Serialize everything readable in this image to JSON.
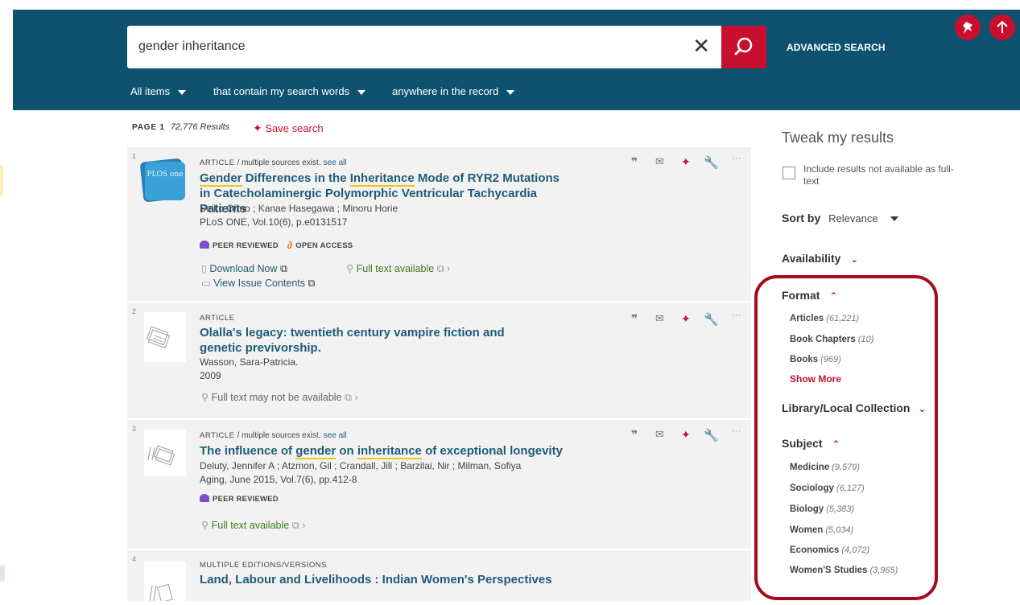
{
  "search": {
    "query": "gender inheritance",
    "advanced_label": "ADVANCED SEARCH",
    "filters": [
      "All items",
      "that contain my search words",
      "anywhere in the record"
    ]
  },
  "results_meta": {
    "page_label": "PAGE 1",
    "count": "72,776 Results",
    "save_search": "Save search"
  },
  "results": [
    {
      "index": "1",
      "type": "ARTICLE",
      "multi_sources": "/ multiple sources exist.",
      "see_all": "see all",
      "title_parts": [
        "Gender",
        " Differences in the ",
        "Inheritance",
        " Mode of RYR2 Mutations in Catecholaminergic Polymorphic Ventricular Tachycardia Patients"
      ],
      "authors": "Seiko Ohno ; Kanae Hasegawa ; Minoru Horie",
      "source": "PLoS ONE, Vol.10(6), p.e0131517",
      "peer_reviewed": "PEER REVIEWED",
      "open_access": "OPEN ACCESS",
      "download": "Download Now",
      "full_text": "Full text available",
      "issue_contents": "View Issue Contents",
      "thumb_text": "PLOS one"
    },
    {
      "index": "2",
      "type": "ARTICLE",
      "title": "Olalla's legacy: twentieth century vampire fiction and genetic previvorship.",
      "authors": "Wasson, Sara-Patricia.",
      "year": "2009",
      "full_text": "Full text may not be available"
    },
    {
      "index": "3",
      "type": "ARTICLE",
      "multi_sources": "/ multiple sources exist.",
      "see_all": "see all",
      "title_parts": [
        "The influence of ",
        "gender",
        " on ",
        "inheritance",
        " of exceptional longevity"
      ],
      "authors": "Deluty, Jennifer A ; Atzmon, Gil ; Crandall, Jill ; Barzilai, Nir ; Milman, Sofiya",
      "source": "Aging, June 2015, Vol.7(6), pp.412-8",
      "peer_reviewed": "PEER REVIEWED",
      "full_text": "Full text available"
    },
    {
      "index": "4",
      "type": "MULTIPLE EDITIONS/VERSIONS",
      "title": "Land, Labour and Livelihoods : Indian Women's Perspectives"
    }
  ],
  "sidebar": {
    "tweak_title": "Tweak my results",
    "include_label": "Include results not available as full-text",
    "sort_label": "Sort by",
    "sort_value": "Relevance",
    "availability": "Availability",
    "format": {
      "heading": "Format",
      "items": [
        {
          "label": "Articles",
          "count": "(61,221)"
        },
        {
          "label": "Book Chapters",
          "count": "(10)"
        },
        {
          "label": "Books",
          "count": "(969)"
        }
      ],
      "show_more": "Show More"
    },
    "library": "Library/Local Collection",
    "subject": {
      "heading": "Subject",
      "items": [
        {
          "label": "Medicine",
          "count": "(9,579)"
        },
        {
          "label": "Sociology",
          "count": "(6,127)"
        },
        {
          "label": "Biology",
          "count": "(5,383)"
        },
        {
          "label": "Women",
          "count": "(5,034)"
        },
        {
          "label": "Economics",
          "count": "(4,072)"
        },
        {
          "label": "Women'S Studies",
          "count": "(3,965)"
        }
      ]
    }
  },
  "colors": {
    "header_bg": "#0f5270",
    "accent": "#c8102e",
    "link": "#1f5b7a",
    "green": "#3a7d1f",
    "highlight": "#f0c419",
    "annotation_frame": "#a5091b"
  }
}
